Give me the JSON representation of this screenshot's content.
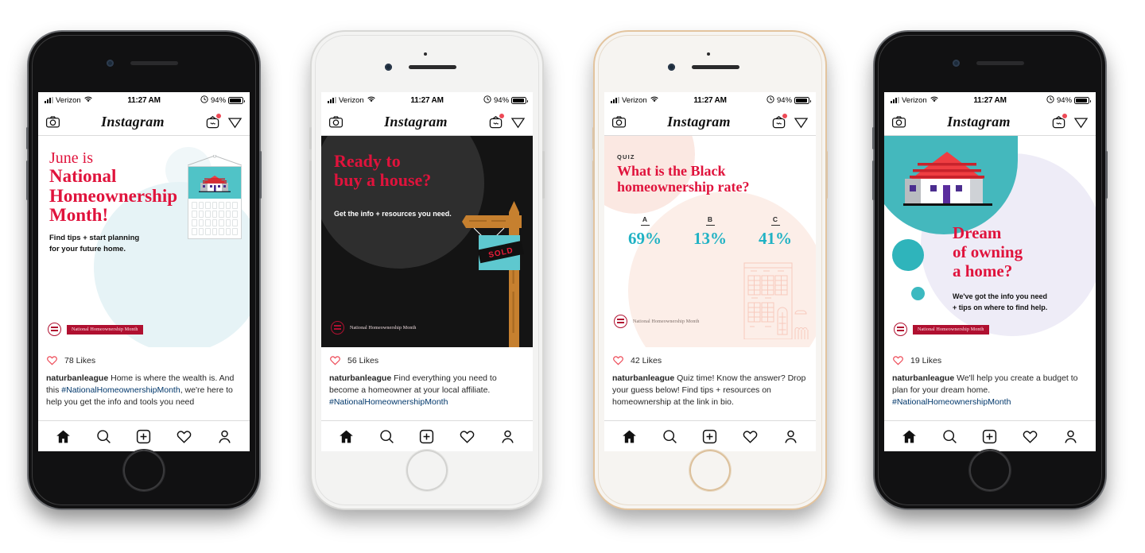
{
  "colors": {
    "brand_red": "#e0133c",
    "deep_red": "#b01030",
    "teal": "#20b2c4",
    "teal_dark": "#44b8bd",
    "lavender": "#eeecf7",
    "peach": "#fbe8e2",
    "ig_link": "#00376b",
    "ig_heart": "#ed4956",
    "dark_bg": "#141414"
  },
  "status_bar": {
    "carrier": "Verizon",
    "time": "11:27 AM",
    "battery_pct": "94%",
    "signal_icon": "signal-bars-icon",
    "wifi_icon": "wifi-icon",
    "alarm_icon": "alarm-icon",
    "battery_icon": "battery-icon"
  },
  "ig_header": {
    "camera_icon": "camera-icon",
    "logo": "Instagram",
    "igtv_icon": "igtv-icon",
    "direct_icon": "paper-plane-icon",
    "has_notification_badge": true
  },
  "tab_bar": {
    "items": [
      {
        "name": "home-icon",
        "label": "Home"
      },
      {
        "name": "search-icon",
        "label": "Search"
      },
      {
        "name": "add-post-icon",
        "label": "New Post"
      },
      {
        "name": "activity-heart-icon",
        "label": "Activity"
      },
      {
        "name": "profile-icon",
        "label": "Profile"
      }
    ]
  },
  "badge": {
    "logo_mark": "nhm-logo-mark",
    "text": "National Homeownership Month"
  },
  "phones": [
    {
      "frame_color": "black",
      "post": {
        "id": "post-june-is-nhm",
        "headline_line1": "June is",
        "headline_line2": "National",
        "headline_line3": "Homeownership",
        "headline_line4": "Month!",
        "subhead_line1": "Find tips + start planning",
        "subhead_line2": "for your future home.",
        "illustration": "calendar-with-house-icon"
      },
      "likes": "78 Likes",
      "caption": {
        "username": "naturbanleague",
        "text_before": "Home is where the wealth is. And this ",
        "hashtag": "#NationalHomeownershipMonth",
        "text_after": ", we're here to help you get the info and tools you need"
      }
    },
    {
      "frame_color": "white",
      "post": {
        "id": "post-ready-to-buy",
        "headline_line1": "Ready to",
        "headline_line2": "buy a house?",
        "subhead_line1": "Get the info + resources you need.",
        "illustration": "sold-yard-sign-icon",
        "sign_text": "SOLD"
      },
      "likes": "56 Likes",
      "caption": {
        "username": "naturbanleague",
        "text_before": "Find everything you need to become a homeowner at your local affiliate.",
        "hashtag": "#NationalHomeownershipMonth",
        "text_after": ""
      }
    },
    {
      "frame_color": "gold",
      "post": {
        "id": "post-quiz-black-homeownership",
        "kicker": "QUIZ",
        "headline_line1": "What is the Black",
        "headline_line2": "homeownership rate?",
        "options": [
          {
            "letter": "A",
            "value": "69%"
          },
          {
            "letter": "B",
            "value": "13%"
          },
          {
            "letter": "C",
            "value": "41%"
          }
        ],
        "illustration": "brownstone-outline-icon"
      },
      "likes": "42 Likes",
      "caption": {
        "username": "naturbanleague",
        "text_before": "Quiz time! Know the answer? Drop your guess below! Find tips + resources on homeownership at the link in bio.",
        "hashtag": "",
        "text_after": ""
      }
    },
    {
      "frame_color": "black",
      "post": {
        "id": "post-dream-of-owning",
        "headline_line1": "Dream",
        "headline_line2": "of owning",
        "headline_line3": "a home?",
        "subhead_line1": "We've got the info you need",
        "subhead_line2": "+ tips on where to find help.",
        "illustration": "house-on-hill-icon"
      },
      "likes": "19 Likes",
      "caption": {
        "username": "naturbanleague",
        "text_before": "We'll help you create a budget to plan for your dream home.",
        "hashtag": "#NationalHomeownershipMonth",
        "text_after": ""
      }
    }
  ]
}
